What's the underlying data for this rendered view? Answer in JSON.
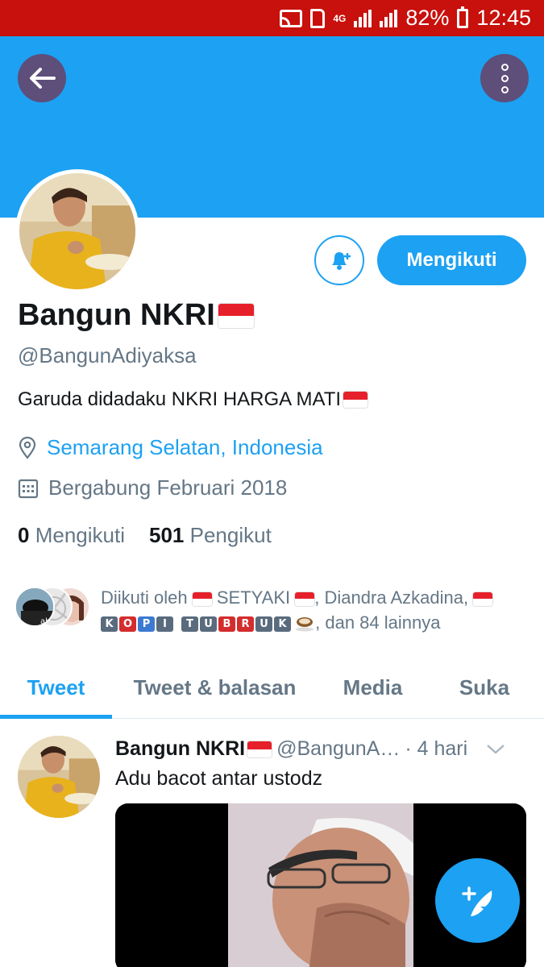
{
  "status_bar": {
    "network": "4G",
    "battery": "82%",
    "time": "12:45"
  },
  "header": {
    "back_icon": "arrow-left-icon",
    "more_icon": "more-vertical-icon"
  },
  "profile": {
    "display_name": "Bangun NKRI",
    "handle": "@BangunAdiyaksa",
    "bio": "Garuda didadaku NKRI HARGA MATI",
    "location": "Semarang Selatan, Indonesia",
    "joined": "Bergabung Februari 2018",
    "following_count": "0",
    "following_label": "Mengikuti",
    "followers_count": "501",
    "followers_label": "Pengikut",
    "follow_button_label": "Mengikuti",
    "notify_icon": "bell-plus-icon"
  },
  "followed_by": {
    "prefix": "Diikuti oleh",
    "name1": "SETYAKI",
    "name2": "Diandra Azkadina,",
    "kopi_letters": [
      "K",
      "O",
      "P",
      "I",
      "T",
      "U",
      "B",
      "R",
      "U",
      "K"
    ],
    "suffix": ", dan 84 lainnya"
  },
  "tabs": [
    {
      "label": "Tweet",
      "active": true
    },
    {
      "label": "Tweet & balasan",
      "active": false
    },
    {
      "label": "Media",
      "active": false
    },
    {
      "label": "Suka",
      "active": false
    }
  ],
  "tweet": {
    "author": "Bangun NKRI",
    "handle": "@BangunA…",
    "time": "· 4 hari",
    "text": "Adu bacot antar ustodz"
  },
  "colors": {
    "status_bar": "#c8100c",
    "accent": "#1da1f2",
    "round_button": "#5d4e7a",
    "secondary_text": "#657786"
  }
}
